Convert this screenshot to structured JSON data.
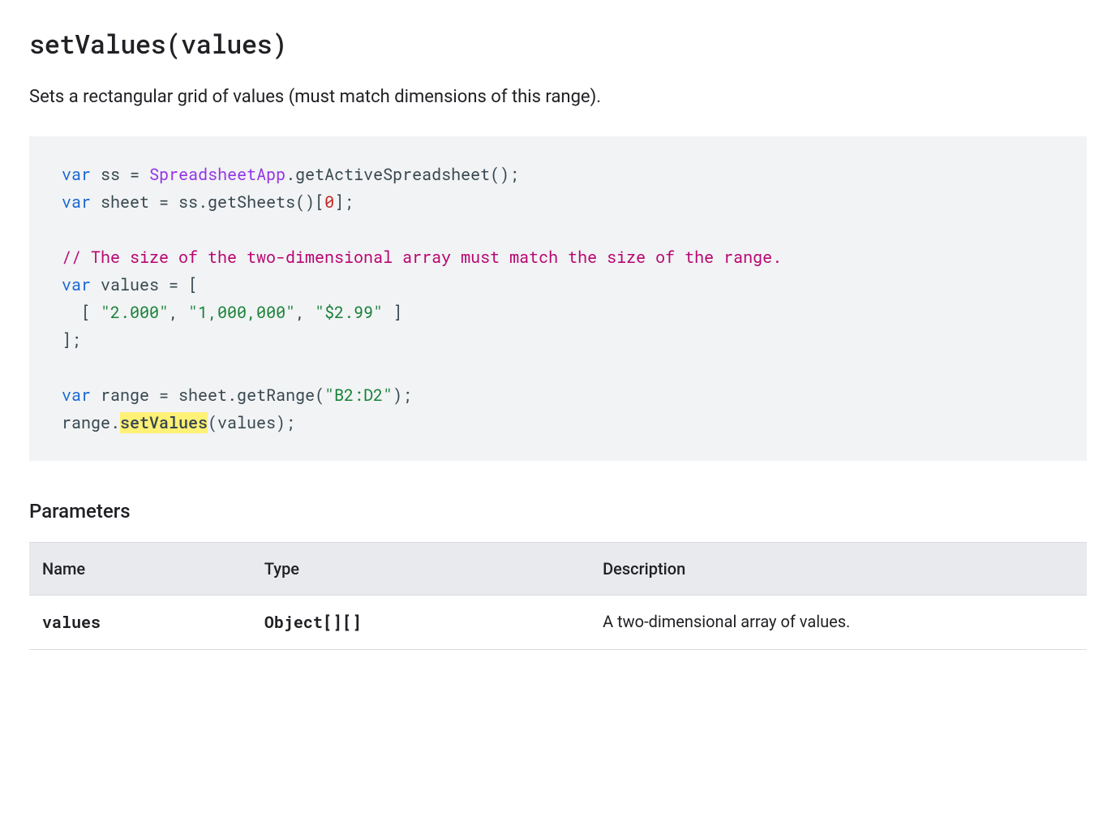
{
  "method": {
    "signature": "setValues(values)",
    "description": "Sets a rectangular grid of values (must match dimensions of this range)."
  },
  "code": {
    "line1_kw": "var",
    "line1_a": " ss ",
    "line1_eq": "=",
    "line1_sp": " ",
    "line1_typ": "SpreadsheetApp",
    "line1_b": ".getActiveSpreadsheet();",
    "line2_kw": "var",
    "line2_a": " sheet ",
    "line2_eq": "=",
    "line2_b": " ss.getSheets()[",
    "line2_num": "0",
    "line2_c": "];",
    "line3_com": "// The size of the two-dimensional array must match the size of the range.",
    "line4_kw": "var",
    "line4_a": " values ",
    "line4_eq": "=",
    "line4_b": " [",
    "line5_a": "  [ ",
    "line5_s1": "\"2.000\"",
    "line5_c1": ", ",
    "line5_s2": "\"1,000,000\"",
    "line5_c2": ", ",
    "line5_s3": "\"$2.99\"",
    "line5_b": " ]",
    "line6_a": "];",
    "line7_kw": "var",
    "line7_a": " range ",
    "line7_eq": "=",
    "line7_b": " sheet.getRange(",
    "line7_str": "\"B2:D2\"",
    "line7_c": ");",
    "line8_a": "range.",
    "line8_hl": "setValues",
    "line8_b": "(values);"
  },
  "parameters": {
    "heading": "Parameters",
    "headers": {
      "name": "Name",
      "type": "Type",
      "description": "Description"
    },
    "rows": [
      {
        "name": "values",
        "type": "Object[][]",
        "description": "A two-dimensional array of values."
      }
    ]
  }
}
